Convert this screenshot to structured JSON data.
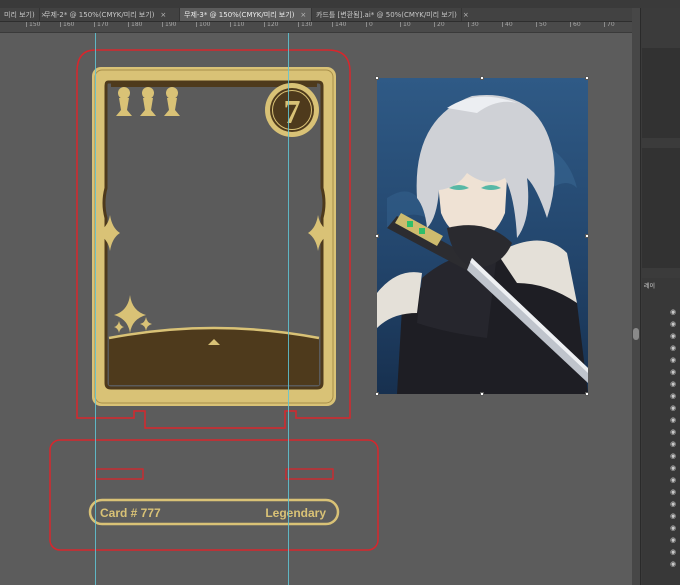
{
  "tabs": [
    {
      "label": "미리 보기)",
      "active": false
    },
    {
      "label": "무제-2* @ 150%(CMYK/미리 보기)",
      "active": false
    },
    {
      "label": "무제-3* @ 150%(CMYK/미리 보기)",
      "active": true
    },
    {
      "label": "카드틀 [변환됨].ai* @ 50%(CMYK/미리 보기)",
      "active": false
    }
  ],
  "tab_close": "×",
  "ruler_ticks": [
    "150",
    "160",
    "170",
    "180",
    "190",
    "100",
    "110",
    "120",
    "130",
    "140",
    "0",
    "10",
    "20",
    "30",
    "40",
    "50",
    "60",
    "70",
    "80"
  ],
  "card": {
    "number": "7",
    "caption_left": "Card # 777",
    "caption_right": "Legendary"
  },
  "panel": {
    "layers_label": "레이"
  },
  "colors": {
    "gold": "#d9c276",
    "gold_dark": "#a88f4a",
    "card_brown": "#4e3a1c",
    "cut_line": "#d8262c",
    "guide": "#5fc6d6",
    "canvas": "#5c5c5c"
  },
  "icons": {
    "pawn": "pawn-icon",
    "sparkle": "sparkle-icon",
    "eye": "eye-icon"
  }
}
